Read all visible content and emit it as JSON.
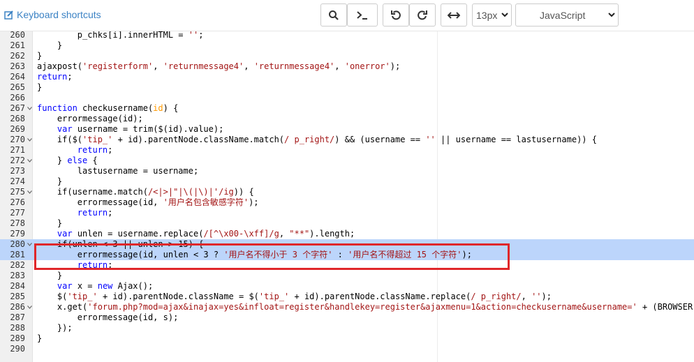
{
  "toolbar": {
    "keyboard_shortcuts": "Keyboard shortcuts",
    "font_size": "13px",
    "language": "JavaScript"
  },
  "colors": {
    "keyword": "#0000ff",
    "string": "#a31515",
    "param": "#ff9900",
    "highlight": "#bcd5fb",
    "annotation": "#e0272a"
  },
  "lines": [
    {
      "n": "260",
      "fold": false,
      "hl": false,
      "parts": [
        [
          "t",
          "        p_chks[i].innerHTML = "
        ],
        [
          "s",
          "''"
        ],
        [
          "t",
          ";"
        ]
      ]
    },
    {
      "n": "261",
      "fold": false,
      "hl": false,
      "parts": [
        [
          "t",
          "    }"
        ]
      ]
    },
    {
      "n": "262",
      "fold": false,
      "hl": false,
      "parts": [
        [
          "t",
          "}"
        ]
      ]
    },
    {
      "n": "263",
      "fold": false,
      "hl": false,
      "parts": [
        [
          "t",
          "ajaxpost("
        ],
        [
          "s",
          "'registerform'"
        ],
        [
          "t",
          ", "
        ],
        [
          "s",
          "'returnmessage4'"
        ],
        [
          "t",
          ", "
        ],
        [
          "s",
          "'returnmessage4'"
        ],
        [
          "t",
          ", "
        ],
        [
          "s",
          "'onerror'"
        ],
        [
          "t",
          ");"
        ]
      ]
    },
    {
      "n": "264",
      "fold": false,
      "hl": false,
      "parts": [
        [
          "k",
          "return"
        ],
        [
          "t",
          ";"
        ]
      ]
    },
    {
      "n": "265",
      "fold": false,
      "hl": false,
      "parts": [
        [
          "t",
          "}"
        ]
      ]
    },
    {
      "n": "266",
      "fold": false,
      "hl": false,
      "parts": []
    },
    {
      "n": "267",
      "fold": true,
      "hl": false,
      "parts": [
        [
          "k",
          "function"
        ],
        [
          "t",
          " checkusername("
        ],
        [
          "p",
          "id"
        ],
        [
          "t",
          ") {"
        ]
      ]
    },
    {
      "n": "268",
      "fold": false,
      "hl": false,
      "parts": [
        [
          "t",
          "    errormessage(id);"
        ]
      ]
    },
    {
      "n": "269",
      "fold": false,
      "hl": false,
      "parts": [
        [
          "t",
          "    "
        ],
        [
          "k",
          "var"
        ],
        [
          "t",
          " username = trim($(id).value);"
        ]
      ]
    },
    {
      "n": "270",
      "fold": true,
      "hl": false,
      "parts": [
        [
          "t",
          "    if($("
        ],
        [
          "s",
          "'tip_'"
        ],
        [
          "t",
          " + id).parentNode.className.match("
        ],
        [
          "s",
          "/ p_right/"
        ],
        [
          "t",
          ") && (username == "
        ],
        [
          "s",
          "''"
        ],
        [
          "t",
          " || username == lastusername)) {"
        ]
      ]
    },
    {
      "n": "271",
      "fold": false,
      "hl": false,
      "parts": [
        [
          "t",
          "        "
        ],
        [
          "k",
          "return"
        ],
        [
          "t",
          ";"
        ]
      ]
    },
    {
      "n": "272",
      "fold": true,
      "hl": false,
      "parts": [
        [
          "t",
          "    } "
        ],
        [
          "k",
          "else"
        ],
        [
          "t",
          " {"
        ]
      ]
    },
    {
      "n": "273",
      "fold": false,
      "hl": false,
      "parts": [
        [
          "t",
          "        lastusername = username;"
        ]
      ]
    },
    {
      "n": "274",
      "fold": false,
      "hl": false,
      "parts": [
        [
          "t",
          "    }"
        ]
      ]
    },
    {
      "n": "275",
      "fold": true,
      "hl": false,
      "parts": [
        [
          "t",
          "    if(username.match("
        ],
        [
          "s",
          "/<|>|\"|\\(|\\)|'/ig"
        ],
        [
          "t",
          ")) {"
        ]
      ]
    },
    {
      "n": "276",
      "fold": false,
      "hl": false,
      "parts": [
        [
          "t",
          "        errormessage(id, "
        ],
        [
          "s",
          "'用户名包含敏感字符'"
        ],
        [
          "t",
          ");"
        ]
      ]
    },
    {
      "n": "277",
      "fold": false,
      "hl": false,
      "parts": [
        [
          "t",
          "        "
        ],
        [
          "k",
          "return"
        ],
        [
          "t",
          ";"
        ]
      ]
    },
    {
      "n": "278",
      "fold": false,
      "hl": false,
      "parts": [
        [
          "t",
          "    }"
        ]
      ]
    },
    {
      "n": "279",
      "fold": false,
      "hl": false,
      "parts": [
        [
          "t",
          "    "
        ],
        [
          "k",
          "var"
        ],
        [
          "t",
          " unlen = username.replace("
        ],
        [
          "s",
          "/[^\\x00-\\xff]/g"
        ],
        [
          "t",
          ", "
        ],
        [
          "s",
          "\"**\""
        ],
        [
          "t",
          ").length;"
        ]
      ]
    },
    {
      "n": "280",
      "fold": true,
      "hl": true,
      "parts": [
        [
          "t",
          "    if(unlen < 3 || unlen > 15) {"
        ]
      ]
    },
    {
      "n": "281",
      "fold": false,
      "hl": true,
      "parts": [
        [
          "t",
          "        errormessage(id, unlen < 3 ? "
        ],
        [
          "s",
          "'用户名不得小于 3 个字符'"
        ],
        [
          "t",
          " : "
        ],
        [
          "s",
          "'用户名不得超过 15 个字符'"
        ],
        [
          "t",
          ");"
        ]
      ]
    },
    {
      "n": "282",
      "fold": false,
      "hl": false,
      "parts": [
        [
          "t",
          "        "
        ],
        [
          "k",
          "return"
        ],
        [
          "t",
          ";"
        ]
      ]
    },
    {
      "n": "283",
      "fold": false,
      "hl": false,
      "parts": [
        [
          "t",
          "    }"
        ]
      ]
    },
    {
      "n": "284",
      "fold": false,
      "hl": false,
      "parts": [
        [
          "t",
          "    "
        ],
        [
          "k",
          "var"
        ],
        [
          "t",
          " x = "
        ],
        [
          "k",
          "new"
        ],
        [
          "t",
          " Ajax();"
        ]
      ]
    },
    {
      "n": "285",
      "fold": false,
      "hl": false,
      "parts": [
        [
          "t",
          "    $("
        ],
        [
          "s",
          "'tip_'"
        ],
        [
          "t",
          " + id).parentNode.className = $("
        ],
        [
          "s",
          "'tip_'"
        ],
        [
          "t",
          " + id).parentNode.className.replace("
        ],
        [
          "s",
          "/ p_right/"
        ],
        [
          "t",
          ", "
        ],
        [
          "s",
          "''"
        ],
        [
          "t",
          ");"
        ]
      ]
    },
    {
      "n": "286",
      "fold": true,
      "hl": false,
      "parts": [
        [
          "t",
          "    x.get("
        ],
        [
          "s",
          "'forum.php?mod=ajax&inajax=yes&infloat=register&handlekey=register&ajaxmenu=1&action=checkusername&username='"
        ],
        [
          "t",
          " + (BROWSER.ie"
        ]
      ]
    },
    {
      "n": "287",
      "fold": false,
      "hl": false,
      "parts": [
        [
          "t",
          "        errormessage(id, s);"
        ]
      ]
    },
    {
      "n": "288",
      "fold": false,
      "hl": false,
      "parts": [
        [
          "t",
          "    });"
        ]
      ]
    },
    {
      "n": "289",
      "fold": false,
      "hl": false,
      "parts": [
        [
          "t",
          "}"
        ]
      ]
    },
    {
      "n": "290",
      "fold": false,
      "hl": false,
      "parts": []
    }
  ]
}
